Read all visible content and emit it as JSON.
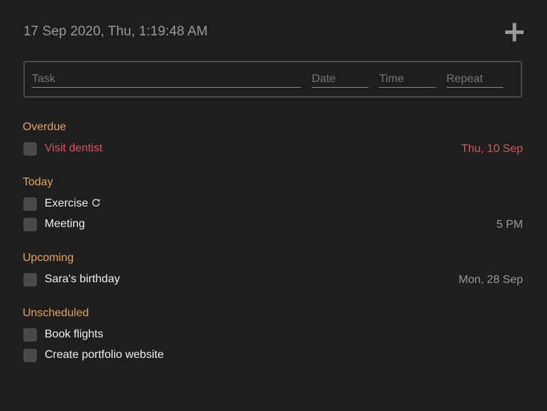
{
  "header": {
    "datetime": "17 Sep 2020, Thu, 1:19:48 AM",
    "add_icon": "plus-icon"
  },
  "entry": {
    "task_placeholder": "Task",
    "date_placeholder": "Date",
    "time_placeholder": "Time",
    "repeat_placeholder": "Repeat"
  },
  "sections": {
    "overdue": {
      "title": "Overdue",
      "tasks": [
        {
          "label": "Visit dentist",
          "date": "Thu, 10 Sep"
        }
      ]
    },
    "today": {
      "title": "Today",
      "tasks": [
        {
          "label": "Exercise",
          "date": "",
          "repeat_icon": "repeat-icon"
        },
        {
          "label": "Meeting",
          "date": "5 PM"
        }
      ]
    },
    "upcoming": {
      "title": "Upcoming",
      "tasks": [
        {
          "label": "Sara's birthday",
          "date": "Mon, 28 Sep"
        }
      ]
    },
    "unscheduled": {
      "title": "Unscheduled",
      "tasks": [
        {
          "label": "Book flights",
          "date": ""
        },
        {
          "label": "Create portfolio website",
          "date": ""
        }
      ]
    }
  },
  "colors": {
    "background": "#1e1e1e",
    "section_title": "#e9a25e",
    "overdue": "#d9575b",
    "muted": "#9a9a9a",
    "checkbox": "#4a4a4a"
  }
}
